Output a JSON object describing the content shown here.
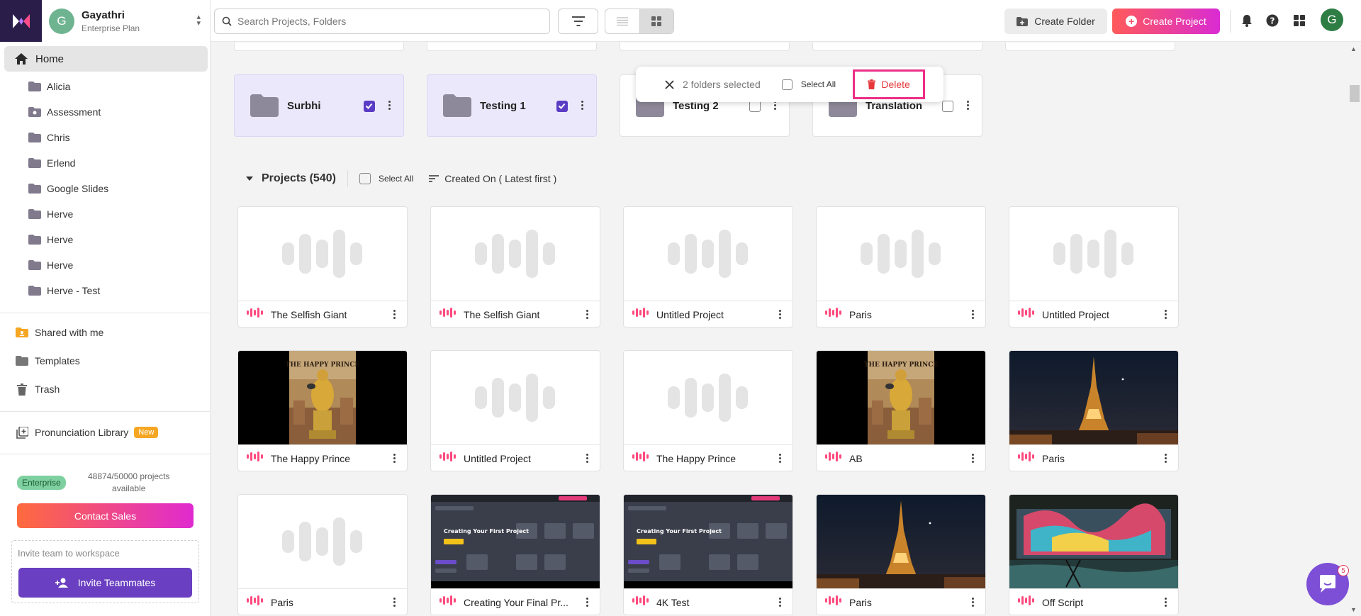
{
  "account": {
    "initial": "G",
    "name": "Gayathri",
    "plan": "Enterprise Plan"
  },
  "sidebar": {
    "home": "Home",
    "folders": [
      "Alicia",
      "Assessment",
      "Chris",
      "Erlend",
      "Google Slides",
      "Herve",
      "Herve",
      "Herve",
      "Herve - Test"
    ],
    "shared": "Shared with me",
    "templates": "Templates",
    "trash": "Trash",
    "pronunciation": "Pronunciation Library",
    "new_badge": "New",
    "enterprise_badge": "Enterprise",
    "projects_available": "48874/50000 projects available",
    "contact_sales": "Contact Sales",
    "invite_placeholder": "Invite team to workspace",
    "invite_button": "Invite Teammates"
  },
  "topbar": {
    "search_placeholder": "Search Projects, Folders",
    "create_folder": "Create Folder",
    "create_project": "Create Project",
    "user_initial": "G"
  },
  "folders_row": [
    {
      "name": "Surbhi",
      "checked": true
    },
    {
      "name": "Testing 1",
      "checked": true
    },
    {
      "name": "Testing 2",
      "checked": false
    },
    {
      "name": "Translation",
      "checked": false
    }
  ],
  "selection_bar": {
    "count_text": "2 folders selected",
    "select_all": "Select All",
    "delete": "Delete"
  },
  "projects": {
    "title": "Projects (540)",
    "select_all": "Select All",
    "sort": "Created On ( Latest first )",
    "cards": [
      {
        "title": "The Selfish Giant",
        "thumb": "placeholder"
      },
      {
        "title": "The Selfish Giant",
        "thumb": "placeholder"
      },
      {
        "title": "Untitled Project",
        "thumb": "placeholder"
      },
      {
        "title": "Paris",
        "thumb": "placeholder"
      },
      {
        "title": "Untitled Project",
        "thumb": "placeholder"
      },
      {
        "title": "The Happy Prince",
        "thumb": "prince"
      },
      {
        "title": "Untitled Project",
        "thumb": "placeholder"
      },
      {
        "title": "The Happy Prince",
        "thumb": "placeholder"
      },
      {
        "title": "AB",
        "thumb": "prince"
      },
      {
        "title": "Paris",
        "thumb": "eiffel"
      },
      {
        "title": "Paris",
        "thumb": "placeholder"
      },
      {
        "title": "Creating Your Final Pr...",
        "thumb": "screen",
        "screen_text": "Creating Your First Project"
      },
      {
        "title": "4K Test",
        "thumb": "screen",
        "screen_text": "Creating Your First Project"
      },
      {
        "title": "Paris",
        "thumb": "eiffel"
      },
      {
        "title": "Off Script",
        "thumb": "graffiti"
      }
    ]
  },
  "prince_caption": "THE HAPPY PRINCE",
  "chat_badge": "5",
  "colors": {
    "accent": "#6a3fc1",
    "brand_gradient_start": "#ff5a5a",
    "brand_gradient_end": "#d92bd3",
    "delete_red": "#e6383b",
    "highlight_pink": "#ec2f86"
  }
}
